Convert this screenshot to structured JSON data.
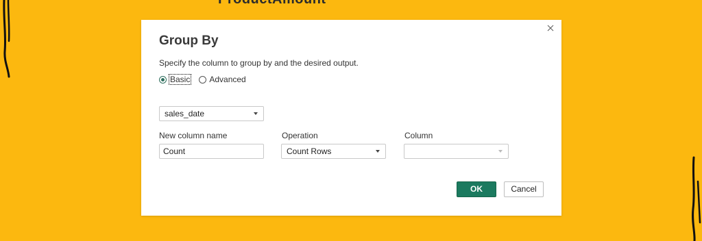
{
  "background": {
    "title": "ProductAmount",
    "color": "#fcb80f"
  },
  "dialog": {
    "title": "Group By",
    "description": "Specify the column to group by and the desired output.",
    "mode_options": [
      {
        "label": "Basic",
        "selected": true
      },
      {
        "label": "Advanced",
        "selected": false
      }
    ],
    "group_by_column": "sales_date",
    "fields": {
      "new_column_name": {
        "label": "New column name",
        "value": "Count"
      },
      "operation": {
        "label": "Operation",
        "value": "Count Rows"
      },
      "column": {
        "label": "Column",
        "value": ""
      }
    },
    "buttons": {
      "ok_label": "OK",
      "cancel_label": "Cancel"
    },
    "close_icon": "close-icon"
  },
  "colors": {
    "accent": "#1b7a5f",
    "radio_selected": "#2f6f5e"
  }
}
